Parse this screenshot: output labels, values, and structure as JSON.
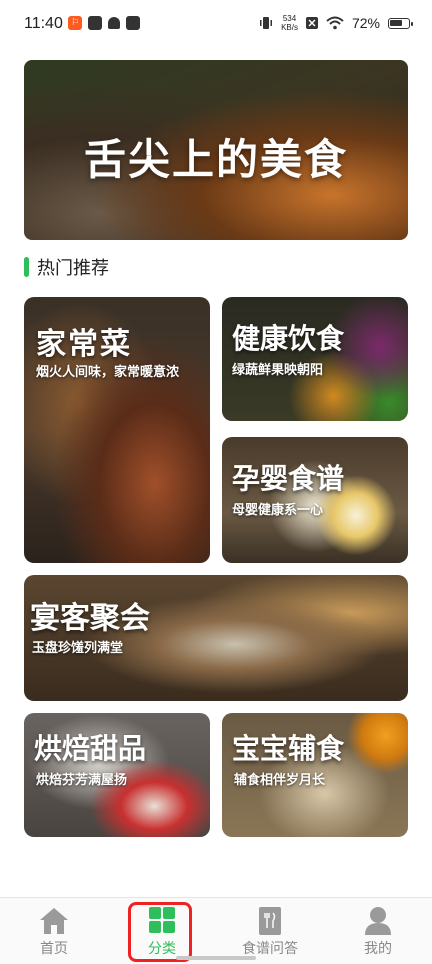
{
  "status_bar": {
    "time": "11:40",
    "net_speed_value": "534",
    "net_speed_unit": "KB/s",
    "battery_percent": "72%",
    "battery_level": 0.72
  },
  "banner": {
    "title": "舌尖上的美食"
  },
  "section": {
    "title": "热门推荐",
    "accent_color": "#2fbf5a"
  },
  "cards": [
    {
      "title": "家常菜",
      "subtitle": "烟火人间味，家常暖意浓"
    },
    {
      "title": "健康饮食",
      "subtitle": "绿蔬鲜果映朝阳"
    },
    {
      "title": "孕婴食谱",
      "subtitle": "母婴健康系一心"
    },
    {
      "title": "宴客聚会",
      "subtitle": "玉盘珍馐列满堂"
    },
    {
      "title": "烘焙甜品",
      "subtitle": "烘焙芬芳满屋扬"
    },
    {
      "title": "宝宝辅食",
      "subtitle": "辅食相伴岁月长"
    }
  ],
  "bottom_nav": {
    "active_color": "#2fbf5a",
    "items": [
      {
        "label": "首页",
        "icon": "home-icon",
        "active": false
      },
      {
        "label": "分类",
        "icon": "category-grid-icon",
        "active": true
      },
      {
        "label": "食谱问答",
        "icon": "recipe-book-icon",
        "active": false
      },
      {
        "label": "我的",
        "icon": "user-icon",
        "active": false
      }
    ]
  }
}
